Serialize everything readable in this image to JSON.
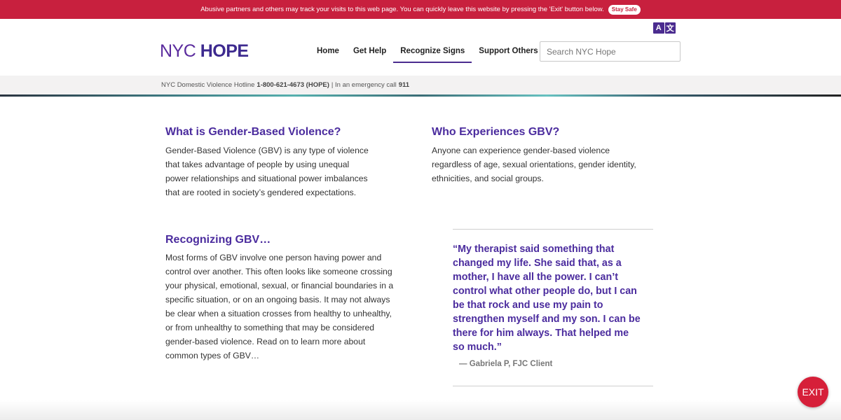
{
  "alert": {
    "text": "Abusive partners and others may track your visits to this web page. You can quickly leave this website by pressing the 'Exit' button below.",
    "stay_safe": "Stay Safe"
  },
  "header": {
    "logo_nyc": "NYC",
    "logo_hope": "HOPE",
    "lang_a": "A",
    "lang_b": "文",
    "nav": [
      "Home",
      "Get Help",
      "Recognize Signs",
      "Support Others"
    ],
    "active_nav": "Recognize Signs",
    "search_placeholder": "Search NYC Hope"
  },
  "hotline": {
    "prefix": "NYC Domestic Violence Hotline",
    "number": "1-800-621-4673 (HOPE)",
    "middle": "| In an emergency call",
    "emergency": "911"
  },
  "sections": {
    "what": {
      "title": "What is Gender-Based Violence?",
      "lines": [
        "Gender-Based Violence (GBV) is any type of violence",
        "that takes advantage of people by using unequal",
        "power relationships and situational power imbalances",
        "that are rooted in society’s gendered expectations."
      ]
    },
    "who": {
      "title": "Who Experiences GBV?",
      "lines": [
        "Anyone can experience gender-based violence",
        "regardless of age, sexual orientations, gender identity,",
        "ethnicities, and social groups."
      ]
    },
    "recognizing": {
      "title": "Recognizing GBV…",
      "lines": [
        "Most forms of GBV involve one person having power and",
        "control over another. This often looks like someone crossing",
        "your physical, emotional, sexual, or financial boundaries in a",
        "specific situation, or on an ongoing basis. It may not always",
        "be clear when a situation crosses from healthy to unhealthy,",
        "or from unhealthy to something that may be considered",
        "gender-based violence. Read on to learn more about",
        "common types of GBV…"
      ]
    }
  },
  "quote": {
    "lines": [
      "“My therapist said something that",
      "changed my life. She said that, as a",
      "mother, I have all the power. I can’t",
      "control what other people do, but I can",
      "be that rock and use my pain to",
      "strengthen myself and my son. I can be",
      "there for him always. That helped me",
      "so much.”"
    ],
    "author": "—   Gabriela P, FJC Client"
  },
  "exit_label": "EXIT",
  "colors": {
    "alert_red": "#c8203e",
    "brand_purple": "#4b2c9e",
    "exit_red": "#d61f39"
  }
}
